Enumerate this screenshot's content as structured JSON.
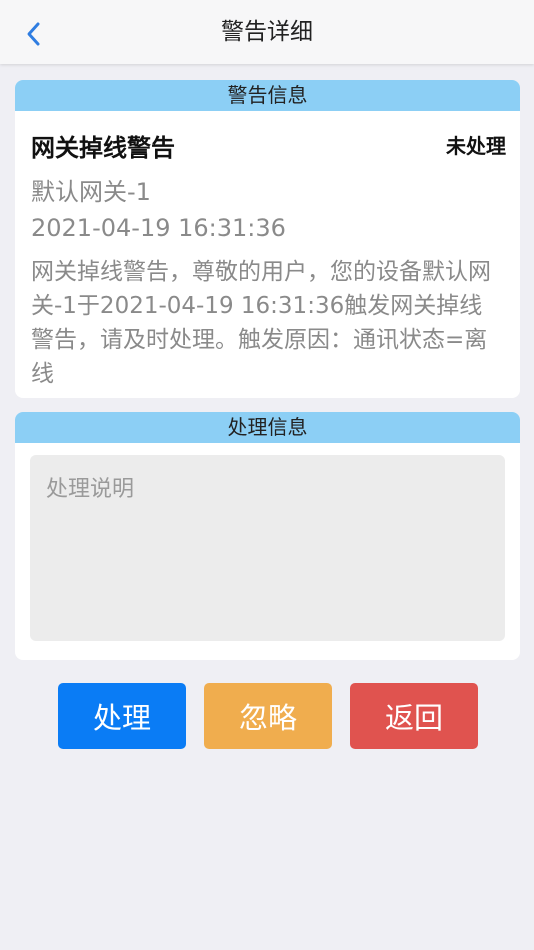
{
  "navbar": {
    "title": "警告详细",
    "back_icon": "chevron-left-icon",
    "accent_color": "#2f7de1"
  },
  "alert_section": {
    "header": "警告信息",
    "title": "网关掉线警告",
    "status": "未处理",
    "device": "默认网关-1",
    "time": "2021-04-19 16:31:36",
    "description": "网关掉线警告，尊敬的用户，您的设备默认网关-1于2021-04-19 16:31:36触发网关掉线警告，请及时处理。触发原因：通讯状态=离线"
  },
  "process_section": {
    "header": "处理信息",
    "note_value": "",
    "note_placeholder": "处理说明"
  },
  "actions": {
    "process_label": "处理",
    "ignore_label": "忽略",
    "back_label": "返回",
    "process_color": "#0a7cf5",
    "ignore_color": "#f0ad4e",
    "back_color": "#e0534f"
  },
  "colors": {
    "section_header_bg": "#8ccff5",
    "page_bg": "#efeff4"
  }
}
